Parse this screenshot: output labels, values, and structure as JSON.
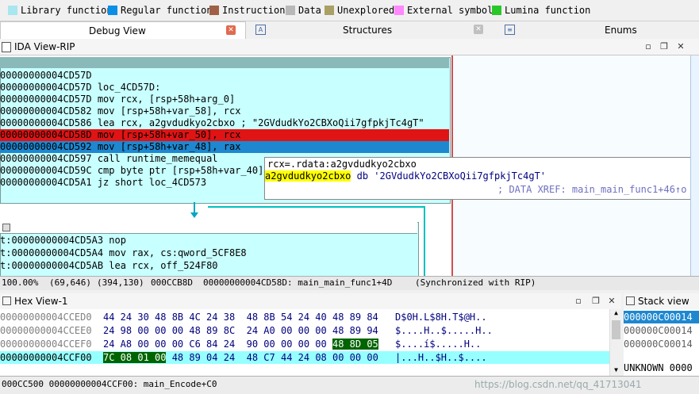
{
  "legend": [
    {
      "label": "Library function",
      "color": "#a8e6f0"
    },
    {
      "label": "Regular function",
      "color": "#0a8ee6"
    },
    {
      "label": "Instruction",
      "color": "#a06048"
    },
    {
      "label": "Data",
      "color": "#b8b8b8"
    },
    {
      "label": "Unexplored",
      "color": "#a8a064"
    },
    {
      "label": "External symbol",
      "color": "#ff88ff"
    },
    {
      "label": "Lumina function",
      "color": "#28c828"
    }
  ],
  "tabs": {
    "debug_view": "Debug View",
    "structures": "Structures",
    "enums": "Enums"
  },
  "ida_view": {
    "title": "IDA View-RIP",
    "lines": [
      "00000000004CD57D",
      "00000000004CD57D loc_4CD57D:",
      "00000000004CD57D mov     rcx, [rsp+58h+arg_0]",
      "00000000004CD582 mov     [rsp+58h+var_58], rcx",
      "00000000004CD586 lea     rcx, a2gvdudkyo2cbxo ; \"2GVdudkYo2CBXoQii7gfpkjTc4gT\"",
      "00000000004CD58D mov     [rsp+58h+var_50], rcx",
      "00000000004CD592 mov     [rsp+58h+var_48], rax",
      "00000000004CD597 call    runtime_memequal",
      "00000000004CD59C cmp     byte ptr [rsp+58h+var_40]",
      "00000000004CD5A1 jz      short loc_4CD573"
    ],
    "lines2": [
      "t:00000000004CD5A3 nop",
      "t:00000000004CD5A4 mov     rax, cs:qword_5CF8E8",
      "t:00000000004CD5AB lea     rcx, off_524F80"
    ],
    "tooltip": {
      "line1": "rcx=.rdata:a2gvdudkyo2cbxo",
      "label": "a2gvdudkyo2cbxo",
      "rest": " db '2GVdudkYo2CBXoQii7gfpkjTc4gT'",
      "xref": "; DATA XREF: main_main_func1+46↑o"
    },
    "status": [
      "100.00%",
      "(69,646)",
      "(394,130)",
      "000CCB8D",
      "00000000004CD58D: main_main_func1+4D",
      "(Synchronized with RIP)"
    ]
  },
  "hex_view": {
    "title": "Hex View-1",
    "rows": [
      {
        "addr": "00000000004CCED0",
        "bytes": "44 24 30 48 8B 4C 24 38  48 8B 54 24 40 48 89 84",
        "ascii": "D$0H.L$8H.T$@H.."
      },
      {
        "addr": "00000000004CCEE0",
        "bytes": "24 98 00 00 00 48 89 8C  24 A0 00 00 00 48 89 94",
        "ascii": "$....H..$.....H.."
      },
      {
        "addr": "00000000004CCEF0",
        "bytes_a": "24 A8 00 00 00 C6 84 24  90 00 00 00 00 ",
        "bytes_hl": "48 8D 05",
        "ascii": "$....í$.....H.."
      },
      {
        "addr": "00000000004CCF00",
        "bytes_hl": "7C 08 01 00",
        "bytes_b": " 48 89 04 24  48 C7 44 24 08 00 00 00",
        "ascii": "|...H..$H..$...."
      }
    ],
    "status": "000CC500 00000000004CCF00: main_Encode+C0"
  },
  "stack_view": {
    "title": "Stack view",
    "rows": [
      "000000C00014",
      "000000C00014",
      "000000C00014"
    ],
    "status": "UNKNOWN 0000"
  },
  "watermark": "https://blog.csdn.net/qq_41713041"
}
